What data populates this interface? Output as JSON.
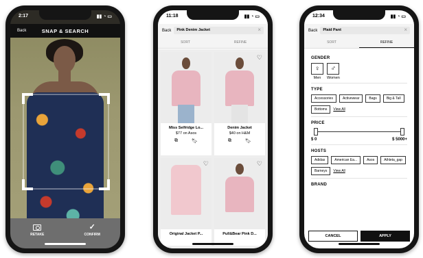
{
  "phone1": {
    "status_time": "2:17",
    "back_label": "Back",
    "title": "SNAP & SEARCH",
    "retake_label": "RETAKE",
    "confirm_label": "CONFIRM"
  },
  "phone2": {
    "status_time": "11:18",
    "back_label": "Back",
    "search_value": "Pink Denim Jacket",
    "tabs": [
      "SORT",
      "REFINE"
    ],
    "products": [
      {
        "name": "Miss Selfridge Lo...",
        "price": "$77 on Asos"
      },
      {
        "name": "Denim Jacket",
        "price": "$40 on H&M"
      },
      {
        "name": "Original Jacket P...",
        "price": ""
      },
      {
        "name": "Pull&Bear Pink D...",
        "price": ""
      }
    ]
  },
  "phone3": {
    "status_time": "12:34",
    "back_label": "Back",
    "search_value": "Plaid Pant",
    "tabs": [
      "SORT",
      "REFINE"
    ],
    "gender_title": "GENDER",
    "gender_options": [
      "Men",
      "Women"
    ],
    "type_title": "TYPE",
    "type_chips": [
      "Accessories",
      "Activewear",
      "Bags",
      "Big & Tall",
      "Bottoms"
    ],
    "view_all": "View All",
    "price_title": "PRICE",
    "price_min": "$ 0",
    "price_max": "$ 5000+",
    "hosts_title": "HOSTS",
    "host_chips": [
      "Adidas",
      "American Ea...",
      "Asos",
      "Athleta_gap",
      "Barneys"
    ],
    "brand_title": "BRAND",
    "cancel_label": "CANCEL",
    "apply_label": "APPLY"
  },
  "icons": {
    "male": "♂",
    "female": "♀",
    "check": "✓",
    "heart": "♡",
    "close": "×"
  }
}
